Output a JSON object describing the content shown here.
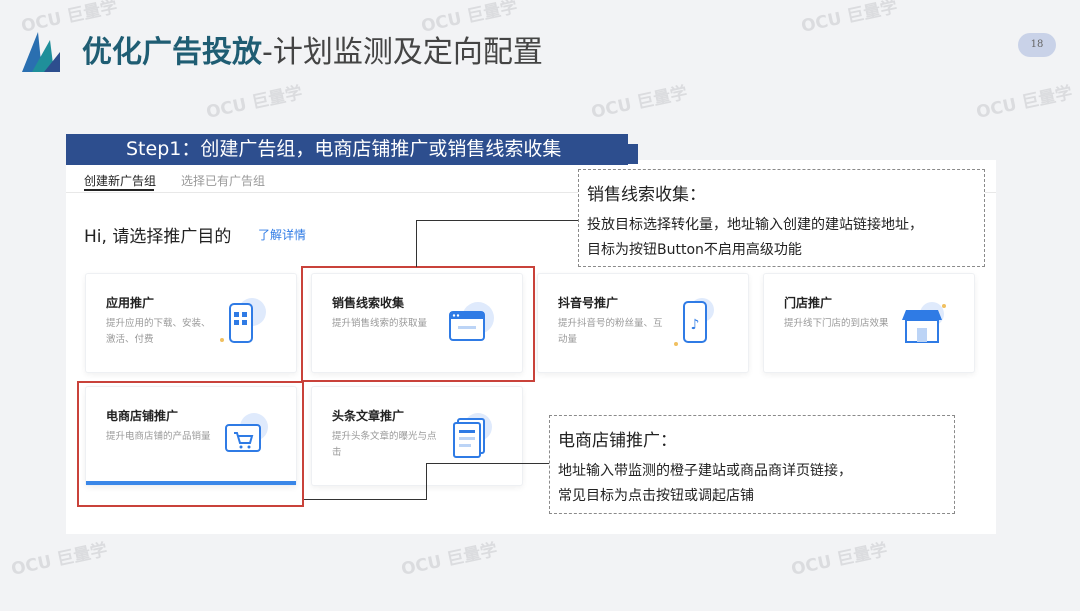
{
  "header": {
    "title_bold": "优化广告投放",
    "title_rest": "-计划监测及定向配置",
    "page_number": "18"
  },
  "watermark": {
    "text": "OCU 巨量学"
  },
  "step_banner": {
    "text": "Step1：创建广告组，电商店铺推广或销售线索收集"
  },
  "tabs": {
    "active": "创建新广告组",
    "inactive": "选择已有广告组"
  },
  "prompt": {
    "text": "Hi, 请选择推广目的",
    "link": "了解详情"
  },
  "cards": [
    {
      "title": "应用推广",
      "desc": "提升应用的下载、安装、激活、付费",
      "icon": "phone-app-icon"
    },
    {
      "title": "销售线索收集",
      "desc": "提升销售线索的获取量",
      "icon": "browser-window-icon"
    },
    {
      "title": "抖音号推广",
      "desc": "提升抖音号的粉丝量、互动量",
      "icon": "douyin-phone-icon"
    },
    {
      "title": "门店推广",
      "desc": "提升线下门店的到店效果",
      "icon": "storefront-icon"
    },
    {
      "title": "电商店铺推广",
      "desc": "提升电商店铺的产品销量",
      "icon": "cart-screen-icon"
    },
    {
      "title": "头条文章推广",
      "desc": "提升头条文章的曝光与点击",
      "icon": "article-doc-icon"
    }
  ],
  "callouts": {
    "leads": {
      "title": "销售线索收集：",
      "line1": "投放目标选择转化量，地址输入创建的建站链接地址，",
      "line2": "目标为按钮Button不启用高级功能"
    },
    "ecommerce": {
      "title": "电商店铺推广：",
      "line1": "地址输入带监测的橙子建站或商品商详页链接，",
      "line2": "常见目标为点击按钮或调起店铺"
    }
  },
  "colors": {
    "title_teal": "#1f5d73",
    "banner_blue": "#2d4e8e",
    "highlight_red": "#c9423a",
    "accent_blue": "#3a87e8",
    "link_blue": "#2f7be5"
  }
}
